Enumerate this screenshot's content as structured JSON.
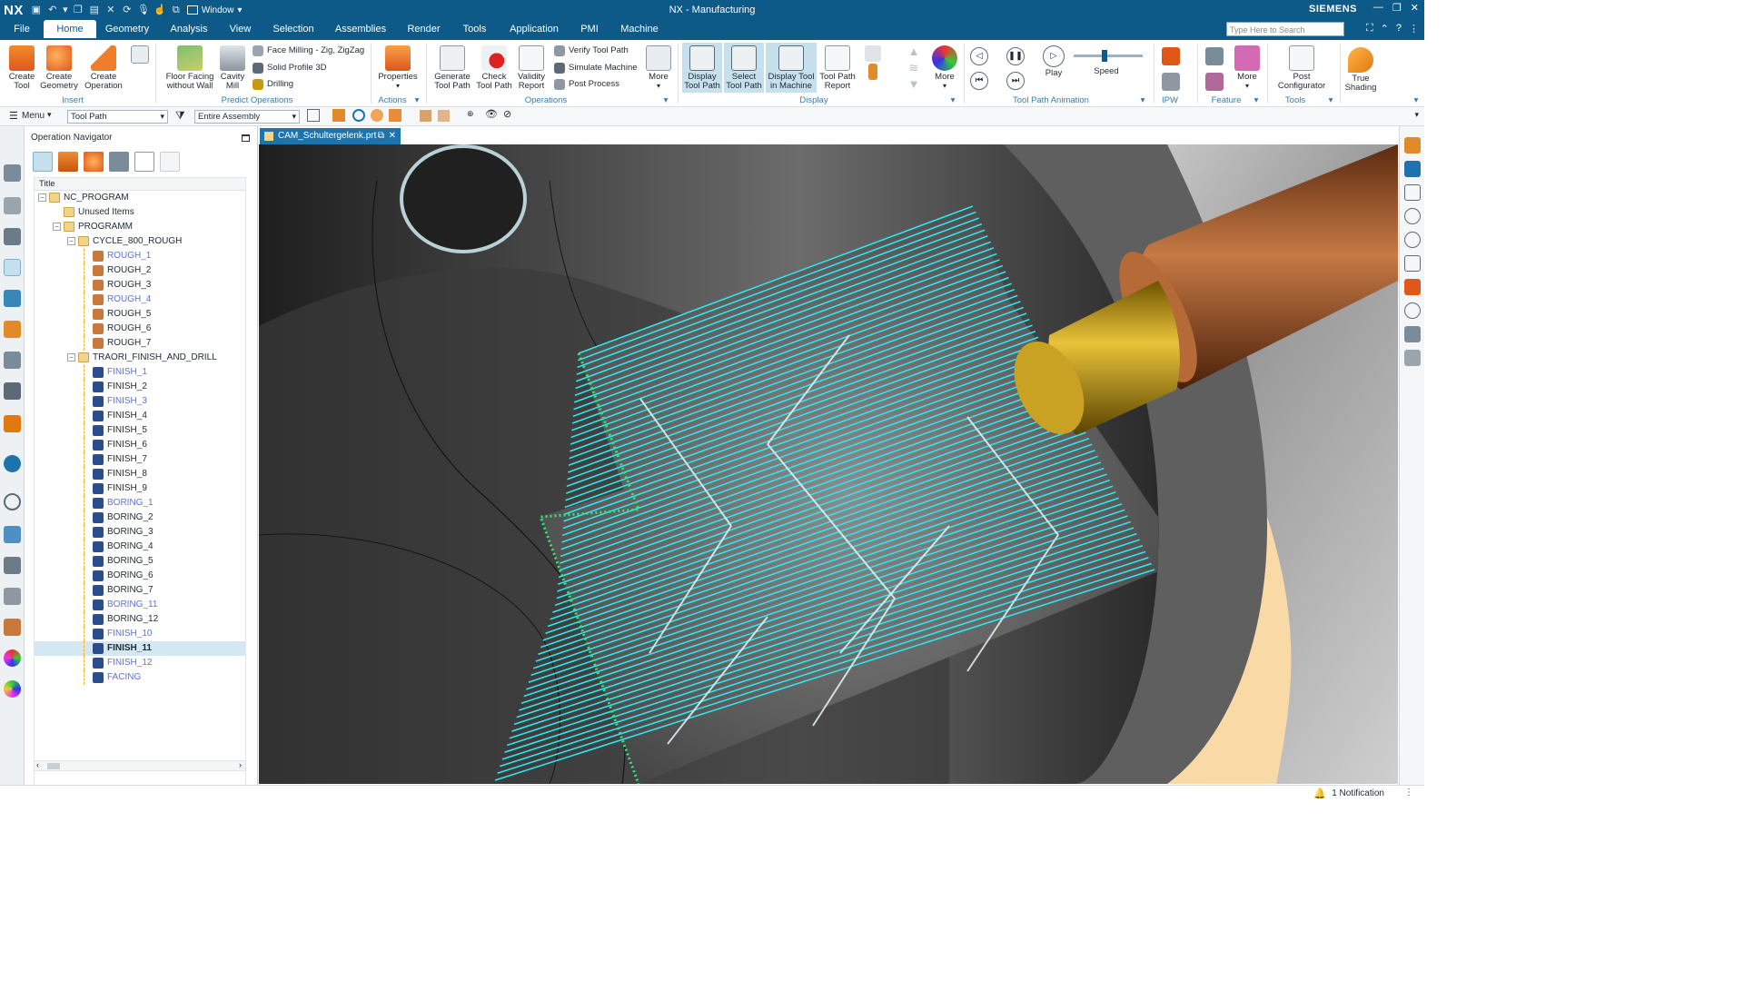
{
  "titlebar": {
    "logo": "NX",
    "window_menu": "Window",
    "title": "NX - Manufacturing",
    "brand": "SIEMENS"
  },
  "tabs": [
    "File",
    "Home",
    "Geometry",
    "Analysis",
    "View",
    "Selection",
    "Assemblies",
    "Render",
    "Tools",
    "Application",
    "PMI",
    "Machine"
  ],
  "search": {
    "placeholder": "Type Here to Search"
  },
  "ribbon": {
    "create_tool": "Create Tool",
    "create_geometry": "Create Geometry",
    "create_operation": "Create Operation",
    "floor_facing": "Floor Facing without Wall",
    "cavity_mill": "Cavity Mill",
    "face_milling": "Face Milling - Zig, ZigZag",
    "solid_profile": "Solid Profile 3D",
    "drilling": "Drilling",
    "properties": "Properties",
    "generate_tool_path": "Generate Tool Path",
    "check_tool_path": "Check Tool Path",
    "validity_report": "Validity Report",
    "verify_tool_path": "Verify Tool Path",
    "simulate_machine": "Simulate Machine",
    "post_process": "Post Process",
    "more": "More",
    "display_tool_path": "Display Tool Path",
    "select_tool_path": "Select Tool Path",
    "display_tool_in_machine": "Display Tool in Machine",
    "tool_path_report": "Tool Path Report",
    "play": "Play",
    "speed": "Speed",
    "post_configurator": "Post Configurator",
    "true_shading": "True Shading",
    "groups": {
      "insert": "Insert",
      "predict_operations": "Predict Operations",
      "actions": "Actions",
      "operations": "Operations",
      "display": "Display",
      "tool_path_animation": "Tool Path Animation",
      "ipw": "IPW",
      "feature": "Feature",
      "tools": "Tools"
    }
  },
  "toolbar": {
    "menu": "Menu",
    "filter": "Tool Path",
    "scope": "Entire Assembly"
  },
  "navigator": {
    "title": "Operation Navigator",
    "column": "Title",
    "rows": [
      {
        "label": "NC_PROGRAM",
        "level": 0,
        "kind": "folder",
        "exp": "−",
        "style": ""
      },
      {
        "label": "Unused Items",
        "level": 1,
        "kind": "folder",
        "exp": "",
        "style": ""
      },
      {
        "label": "PROGRAMM",
        "level": 1,
        "kind": "folder",
        "exp": "−",
        "style": ""
      },
      {
        "label": "CYCLE_800_ROUGH",
        "level": 2,
        "kind": "folder",
        "exp": "−",
        "style": ""
      },
      {
        "label": "ROUGH_1",
        "level": 3,
        "kind": "rough",
        "exp": "",
        "style": "blue"
      },
      {
        "label": "ROUGH_2",
        "level": 3,
        "kind": "rough",
        "exp": "",
        "style": ""
      },
      {
        "label": "ROUGH_3",
        "level": 3,
        "kind": "rough",
        "exp": "",
        "style": ""
      },
      {
        "label": "ROUGH_4",
        "level": 3,
        "kind": "rough",
        "exp": "",
        "style": "blue"
      },
      {
        "label": "ROUGH_5",
        "level": 3,
        "kind": "rough",
        "exp": "",
        "style": ""
      },
      {
        "label": "ROUGH_6",
        "level": 3,
        "kind": "rough",
        "exp": "",
        "style": ""
      },
      {
        "label": "ROUGH_7",
        "level": 3,
        "kind": "rough",
        "exp": "",
        "style": ""
      },
      {
        "label": "TRAORI_FINISH_AND_DRILL",
        "level": 2,
        "kind": "folder",
        "exp": "−",
        "style": ""
      },
      {
        "label": "FINISH_1",
        "level": 3,
        "kind": "finish",
        "exp": "",
        "style": "blue"
      },
      {
        "label": "FINISH_2",
        "level": 3,
        "kind": "finish",
        "exp": "",
        "style": ""
      },
      {
        "label": "FINISH_3",
        "level": 3,
        "kind": "finish",
        "exp": "",
        "style": "blue"
      },
      {
        "label": "FINISH_4",
        "level": 3,
        "kind": "finish",
        "exp": "",
        "style": ""
      },
      {
        "label": "FINISH_5",
        "level": 3,
        "kind": "finish",
        "exp": "",
        "style": ""
      },
      {
        "label": "FINISH_6",
        "level": 3,
        "kind": "finish",
        "exp": "",
        "style": ""
      },
      {
        "label": "FINISH_7",
        "level": 3,
        "kind": "finish",
        "exp": "",
        "style": ""
      },
      {
        "label": "FINISH_8",
        "level": 3,
        "kind": "finish",
        "exp": "",
        "style": ""
      },
      {
        "label": "FINISH_9",
        "level": 3,
        "kind": "finish",
        "exp": "",
        "style": ""
      },
      {
        "label": "BORING_1",
        "level": 3,
        "kind": "boring",
        "exp": "",
        "style": "blue"
      },
      {
        "label": "BORING_2",
        "level": 3,
        "kind": "boring",
        "exp": "",
        "style": ""
      },
      {
        "label": "BORING_3",
        "level": 3,
        "kind": "boring",
        "exp": "",
        "style": ""
      },
      {
        "label": "BORING_4",
        "level": 3,
        "kind": "boring",
        "exp": "",
        "style": ""
      },
      {
        "label": "BORING_5",
        "level": 3,
        "kind": "boring",
        "exp": "",
        "style": ""
      },
      {
        "label": "BORING_6",
        "level": 3,
        "kind": "boring",
        "exp": "",
        "style": ""
      },
      {
        "label": "BORING_7",
        "level": 3,
        "kind": "boring",
        "exp": "",
        "style": ""
      },
      {
        "label": "BORING_11",
        "level": 3,
        "kind": "boring2",
        "exp": "",
        "style": "blue"
      },
      {
        "label": "BORING_12",
        "level": 3,
        "kind": "boring2",
        "exp": "",
        "style": ""
      },
      {
        "label": "FINISH_10",
        "level": 3,
        "kind": "finish",
        "exp": "",
        "style": "blue"
      },
      {
        "label": "FINISH_11",
        "level": 3,
        "kind": "finish",
        "exp": "",
        "style": "bold hl"
      },
      {
        "label": "FINISH_12",
        "level": 3,
        "kind": "finish",
        "exp": "",
        "style": "blue"
      },
      {
        "label": "FACING",
        "level": 3,
        "kind": "finish",
        "exp": "",
        "style": "blue"
      }
    ]
  },
  "graphics_tab": "CAM_Schultergelenk.prt",
  "status": {
    "notification": "1 Notification"
  },
  "colors": {
    "accent": "#0d5a89",
    "toolpath": "#2ee6ee",
    "toolpath_edge": "#37e07a",
    "tool_gold": "#c89a10",
    "tool_copper": "#a7592a",
    "background": "#f9d9a5"
  }
}
